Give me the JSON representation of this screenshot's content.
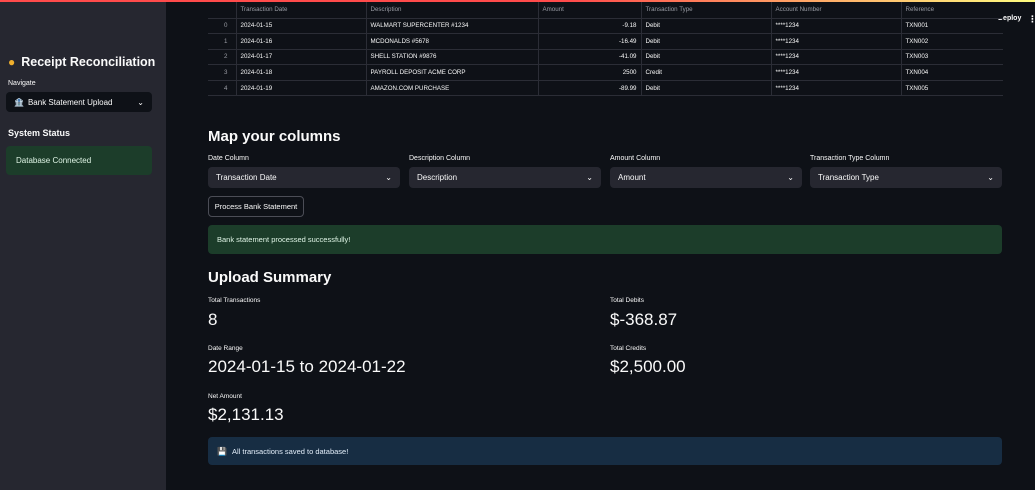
{
  "app": {
    "deploy_label": "Deploy",
    "menu_glyph": "⋮"
  },
  "sidebar": {
    "title": "Receipt Reconciliation",
    "title_icon": "money-bag-icon",
    "navigate_label": "Navigate",
    "nav_selected": "Bank Statement Upload",
    "system_status_heading": "System Status",
    "status_message": "Database Connected"
  },
  "table": {
    "columns": [
      "",
      "Transaction Date",
      "Description",
      "Amount",
      "Transaction Type",
      "Account Number",
      "Reference"
    ],
    "rows": [
      [
        "0",
        "2024-01-15",
        "WALMART SUPERCENTER #1234",
        "-9.18",
        "Debit",
        "****1234",
        "TXN001"
      ],
      [
        "1",
        "2024-01-16",
        "MCDONALDS #5678",
        "-16.49",
        "Debit",
        "****1234",
        "TXN002"
      ],
      [
        "2",
        "2024-01-17",
        "SHELL STATION #9876",
        "-41.09",
        "Debit",
        "****1234",
        "TXN003"
      ],
      [
        "3",
        "2024-01-18",
        "PAYROLL DEPOSIT ACME CORP",
        "2500",
        "Credit",
        "****1234",
        "TXN004"
      ],
      [
        "4",
        "2024-01-19",
        "AMAZON.COM PURCHASE",
        "-89.99",
        "Debit",
        "****1234",
        "TXN005"
      ]
    ]
  },
  "mapping": {
    "heading": "Map your columns",
    "date_label": "Date Column",
    "date_value": "Transaction Date",
    "desc_label": "Description Column",
    "desc_value": "Description",
    "amount_label": "Amount Column",
    "amount_value": "Amount",
    "type_label": "Transaction Type Column",
    "type_value": "Transaction Type",
    "process_button": "Process Bank Statement",
    "success_message": "Bank statement processed successfully!"
  },
  "summary": {
    "heading": "Upload Summary",
    "total_transactions_label": "Total Transactions",
    "total_transactions": "8",
    "total_debits_label": "Total Debits",
    "total_debits": "$-368.87",
    "date_range_label": "Date Range",
    "date_range": "2024-01-15 to 2024-01-22",
    "total_credits_label": "Total Credits",
    "total_credits": "$2,500.00",
    "net_amount_label": "Net Amount",
    "net_amount": "$2,131.13",
    "saved_message": "All transactions saved to database!",
    "saved_icon": "floppy-disk-icon"
  },
  "colors": {
    "success_bg": "#1c3d2a",
    "info_bg": "#172d43",
    "sidebar_bg": "#262730",
    "main_bg": "#0e1117"
  }
}
